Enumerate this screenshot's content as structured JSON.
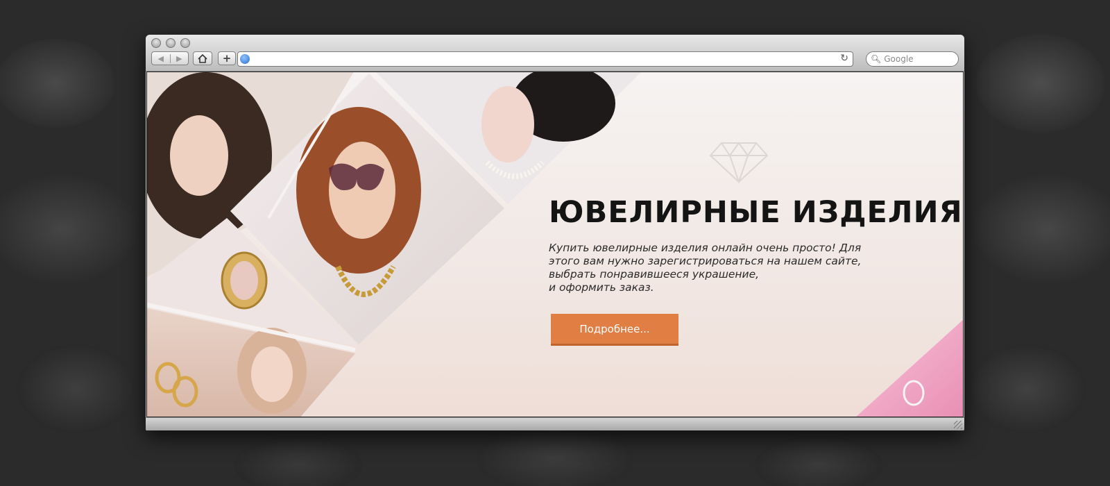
{
  "browser": {
    "search_placeholder": "Google",
    "back_icon": "back-arrow-icon",
    "forward_icon": "forward-arrow-icon",
    "home_icon": "home-icon",
    "add_icon": "plus-icon",
    "reload_icon": "reload-icon",
    "search_icon": "search-icon"
  },
  "hero": {
    "title": "ЮВЕЛИРНЫЕ ИЗДЕЛИЯ",
    "text_lines": [
      "Купить ювелирные изделия онлайн очень просто! Для",
      "этого вам нужно зарегистрироваться на нашем сайте,",
      "выбрать понравившееся украшение,",
      "и оформить заказ."
    ],
    "button_label": "Подробнее...",
    "accent_color": "#e07e44",
    "logo_icon": "diamond-icon"
  }
}
